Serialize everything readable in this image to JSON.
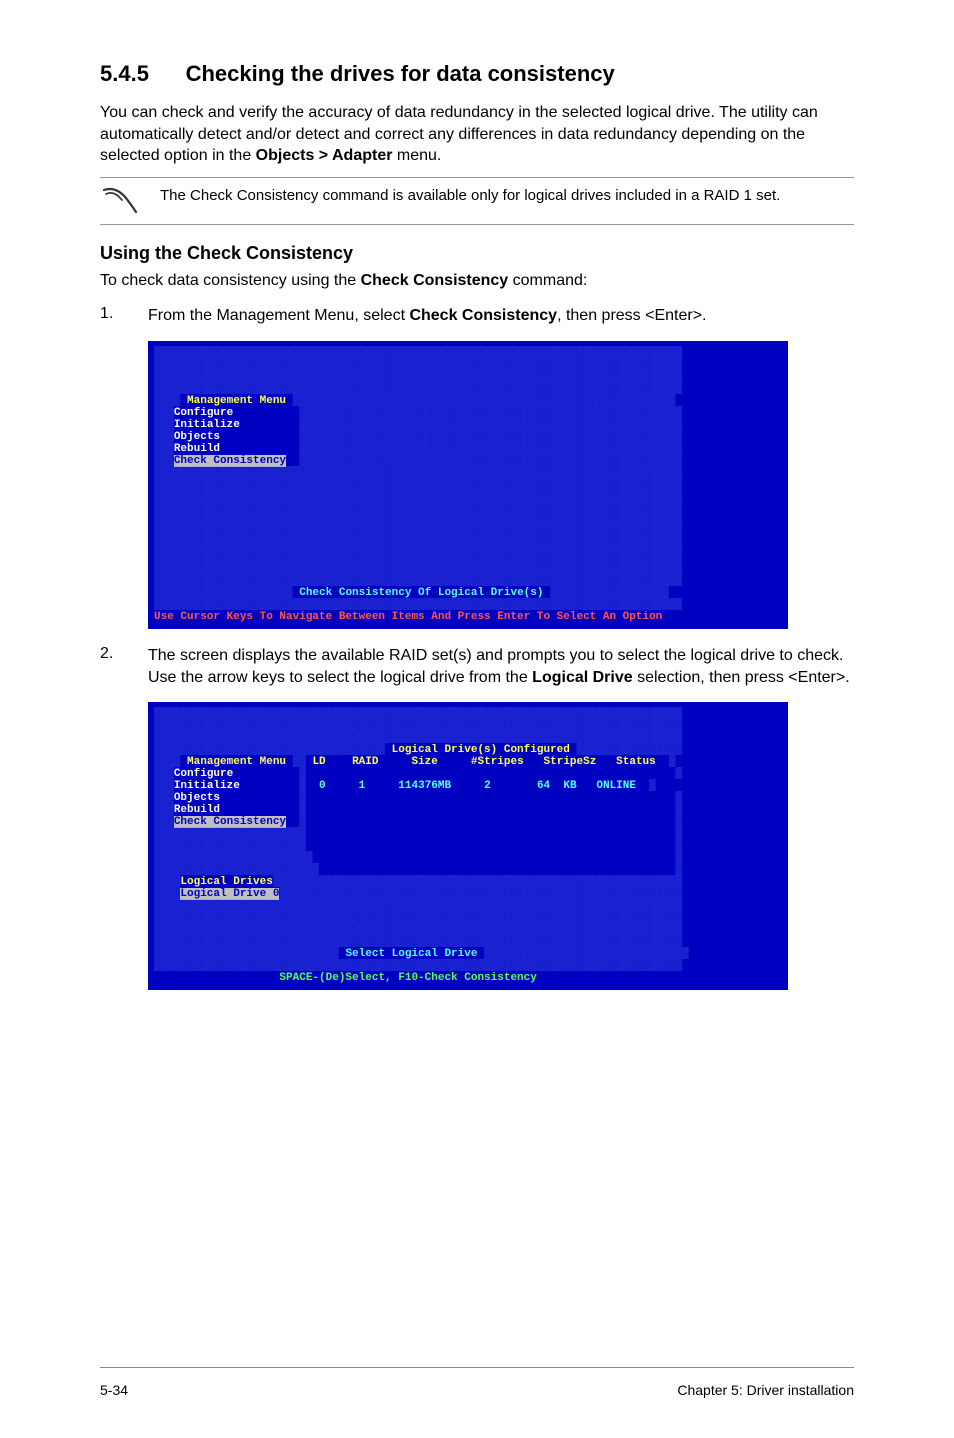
{
  "section": {
    "number": "5.4.5",
    "title": "Checking the drives for data consistency"
  },
  "intro": {
    "p1_pre": "You can check and verify the accuracy of data redundancy in the selected logical drive. The utility can automatically detect and/or detect and correct any differences in data redundancy depending on the selected option in the ",
    "p1_bold": "Objects > Adapter",
    "p1_post": " menu."
  },
  "note": {
    "text": "The Check Consistency command is available only for logical drives included in a RAID 1 set."
  },
  "subheading": "Using the Check Consistency",
  "subintro_pre": "To check data consistency using the ",
  "subintro_bold": "Check Consistency",
  "subintro_post": " command:",
  "steps": {
    "s1": {
      "num": "1.",
      "pre": "From the Management Menu, select ",
      "bold": "Check Consistency",
      "post": ", then press <Enter>."
    },
    "s2": {
      "num": "2.",
      "pre": "The screen displays the available RAID set(s) and prompts you to select the logical drive to check. Use the arrow keys to select the logical drive from the ",
      "bold": "Logical Drive",
      "post": " selection, then press <Enter>."
    }
  },
  "console1": {
    "menu_title": "Management Menu",
    "items": {
      "configure": "Configure",
      "initialize": "Initialize",
      "objects": "Objects",
      "rebuild": "Rebuild",
      "check": "Check Consistency"
    },
    "hint": "Check Consistency Of Logical Drive(s)",
    "statusbar": "Use Cursor Keys To Navigate Between Items And Press Enter To Select An Option"
  },
  "console2": {
    "header": "Logical Drive(s) Configured",
    "cols": {
      "ld": "LD",
      "raid": "RAID",
      "size": "Size",
      "stripes": "#Stripes",
      "stripesz": "StripeSz",
      "status": "Status"
    },
    "row": {
      "ld": "0",
      "raid": "1",
      "size": "114376MB",
      "stripes": "2",
      "stripesz": "64  KB",
      "status": "ONLINE"
    },
    "menu_title": "Management Menu",
    "items": {
      "configure": "Configure",
      "initialize": "Initialize",
      "objects": "Objects",
      "rebuild": "Rebuild",
      "check": "Check Consistency"
    },
    "drives_title": "Logical Drives",
    "drive_row": "Logical Drive 0",
    "hint": "Select Logical Drive",
    "statusbar": "SPACE-(De)Select, F10-Check Consistency"
  },
  "footer": {
    "left": "5-34",
    "right": "Chapter 5: Driver installation"
  }
}
